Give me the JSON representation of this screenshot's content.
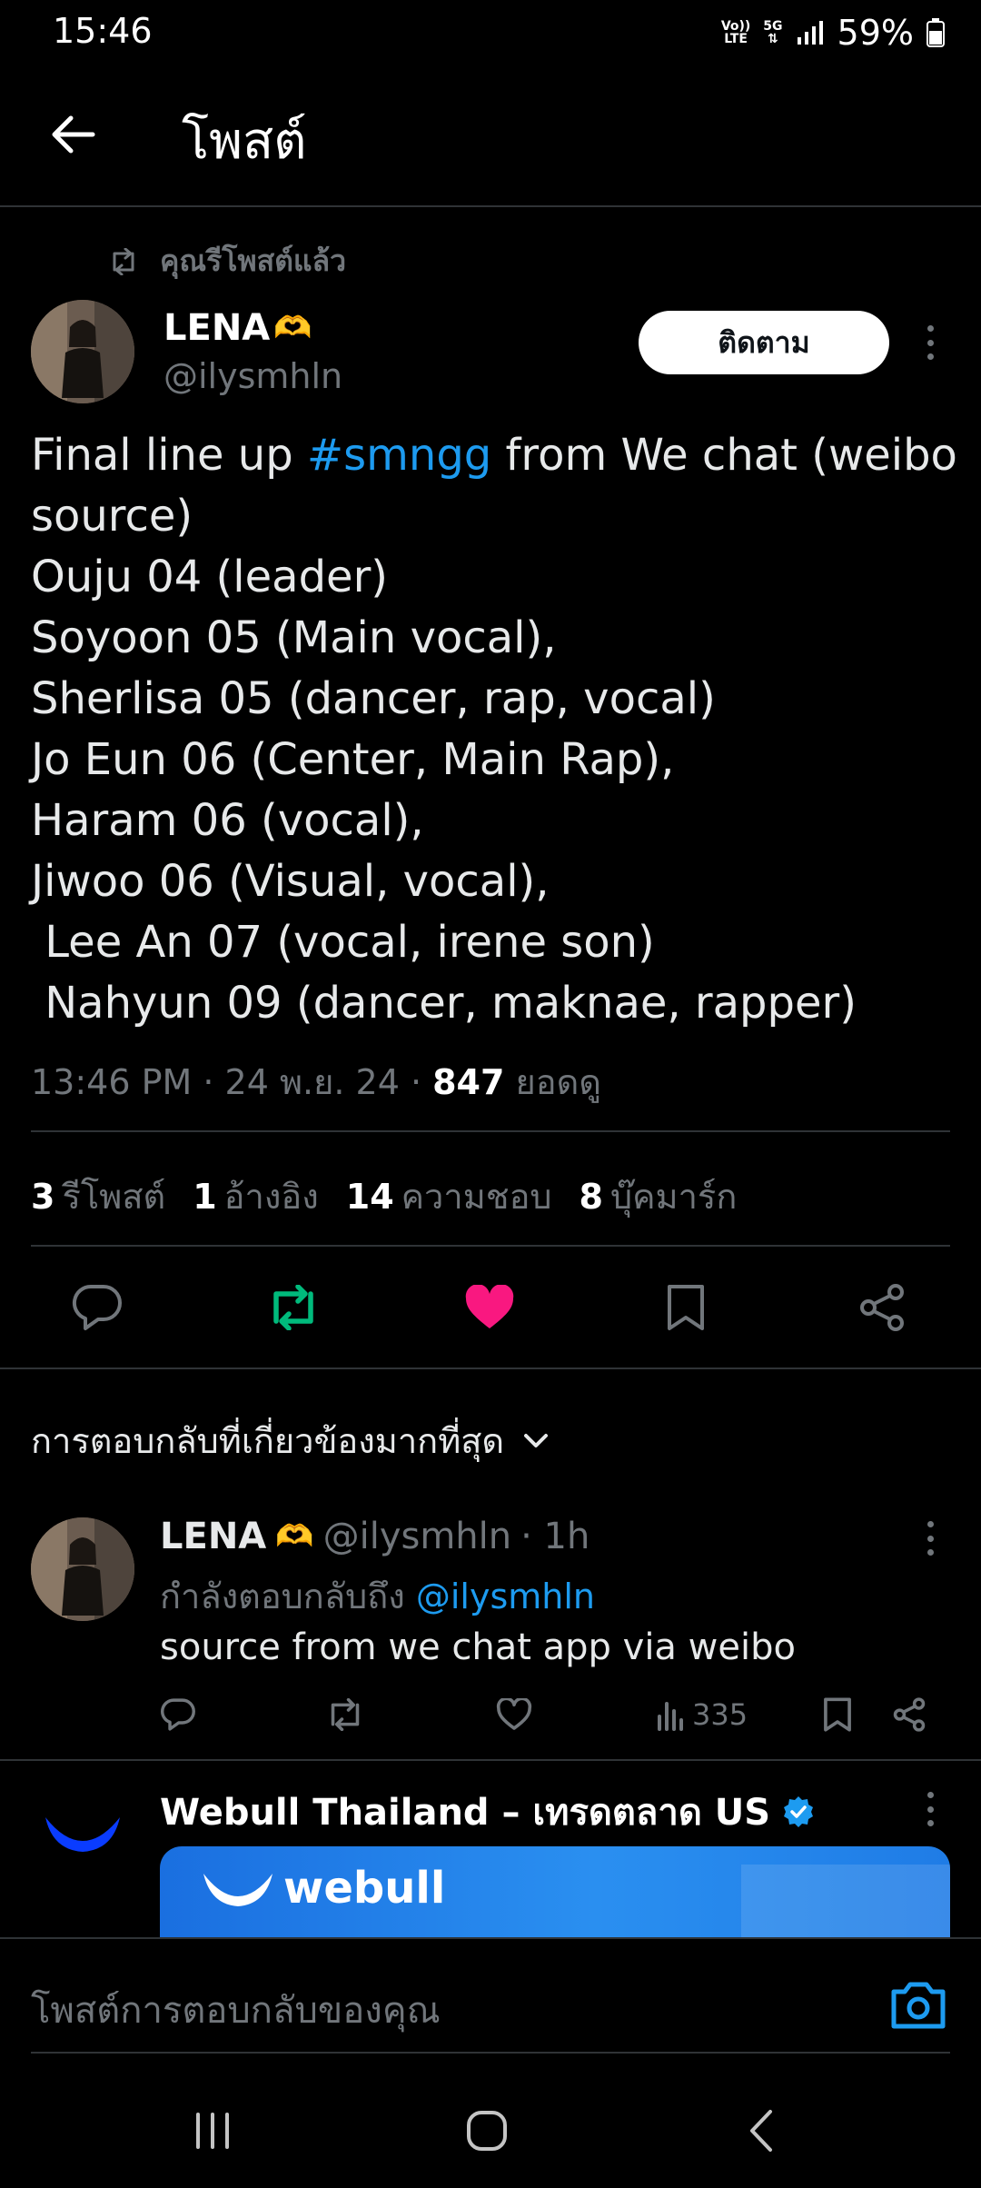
{
  "status_bar": {
    "time": "15:46",
    "volte_top": "Vo))",
    "volte_bottom": "LTE",
    "network": "5G",
    "battery": "59%"
  },
  "header": {
    "title": "โพสต์"
  },
  "tweet": {
    "repost_label": "คุณรีโพสต์แล้ว",
    "author_name": "LENA",
    "author_emoji": "🫶",
    "author_handle": "@ilysmhln",
    "follow_label": "ติดตาม",
    "text_prefix": "Final line up ",
    "hashtag": "#smngg",
    "text_suffix": " from We chat (weibo",
    "lines": [
      "source)",
      "Ouju 04 (leader)",
      "Soyoon 05 (Main vocal),",
      "Sherlisa 05 (dancer, rap, vocal)",
      "Jo Eun 06 (Center, Main Rap),",
      "Haram 06 (vocal),",
      "Jiwoo 06 (Visual, vocal),",
      " Lee An 07 (vocal, irene son)",
      " Nahyun 09 (dancer, maknae, rapper)"
    ],
    "time": "13:46 PM · 24 พ.ย. 24 · ",
    "views": "847",
    "views_label": "ยอดดู",
    "stats": {
      "reposts": "3",
      "reposts_label": "รีโพสต์",
      "quotes": "1",
      "quotes_label": "อ้างอิง",
      "likes": "14",
      "likes_label": "ความชอบ",
      "bookmarks": "8",
      "bookmarks_label": "บุ๊คมาร์ก"
    },
    "colors": {
      "repost_active": "#00ba7c",
      "like_active": "#f91880"
    }
  },
  "replies": {
    "sort_label": "การตอบกลับที่เกี่ยวข้องมากที่สุด",
    "items": [
      {
        "name": "LENA",
        "emoji": "🫶",
        "handle": "@ilysmhln",
        "time": "· 1h",
        "replying_prefix": "กำลังตอบกลับถึง ",
        "replying_to": "@ilysmhln",
        "text": "source from we chat app via weibo",
        "views": "335"
      }
    ]
  },
  "ad": {
    "name": "Webull Thailand – เทรดตลาด US",
    "media_word": "webull"
  },
  "compose": {
    "placeholder": "โพสต์การตอบกลับของคุณ"
  },
  "icons": {
    "back": "arrow-left-icon",
    "repost": "repost-icon",
    "reply": "reply-icon",
    "like": "heart-icon",
    "bookmark": "bookmark-icon",
    "share": "share-icon",
    "camera": "camera-icon",
    "verified": "verified-badge-icon"
  }
}
